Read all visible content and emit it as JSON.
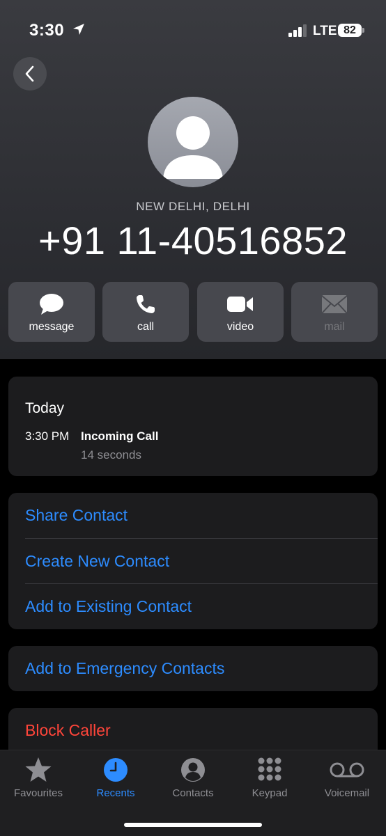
{
  "status_bar": {
    "time": "3:30",
    "network": "LTE",
    "battery": "82"
  },
  "caller": {
    "location": "NEW DELHI, DELHI",
    "number": "+91 11-40516852"
  },
  "actions": [
    {
      "label": "message",
      "icon": "message-bubble-icon",
      "enabled": true
    },
    {
      "label": "call",
      "icon": "phone-icon",
      "enabled": true
    },
    {
      "label": "video",
      "icon": "video-camera-icon",
      "enabled": true
    },
    {
      "label": "mail",
      "icon": "envelope-icon",
      "enabled": false
    }
  ],
  "history": {
    "day": "Today",
    "entries": [
      {
        "time": "3:30 PM",
        "type": "Incoming Call",
        "duration": "14 seconds"
      }
    ]
  },
  "options": [
    "Share Contact",
    "Create New Contact",
    "Add to Existing Contact"
  ],
  "emergency": "Add to Emergency Contacts",
  "block": "Block Caller",
  "tabs": [
    {
      "label": "Favourites",
      "icon": "star-icon",
      "active": false
    },
    {
      "label": "Recents",
      "icon": "clock-icon",
      "active": true
    },
    {
      "label": "Contacts",
      "icon": "person-circle-icon",
      "active": false
    },
    {
      "label": "Keypad",
      "icon": "keypad-icon",
      "active": false
    },
    {
      "label": "Voicemail",
      "icon": "voicemail-icon",
      "active": false
    }
  ],
  "colors": {
    "accent": "#2d8cff",
    "destructive": "#ff453a",
    "card": "#1c1c1e"
  }
}
